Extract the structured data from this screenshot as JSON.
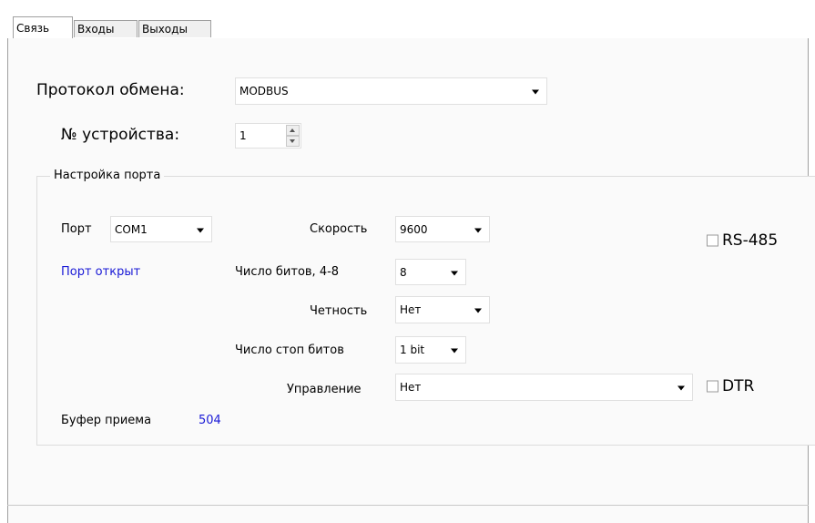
{
  "tabs": [
    {
      "label": "Связь",
      "active": true
    },
    {
      "label": "Входы",
      "active": false
    },
    {
      "label": "Выходы",
      "active": false
    }
  ],
  "protocol": {
    "label": "Протокол обмена:",
    "value": "MODBUS"
  },
  "device": {
    "label": "№ устройства:",
    "value": "1"
  },
  "port_settings": {
    "title": "Настройка порта",
    "port": {
      "label": "Порт",
      "value": "COM1"
    },
    "port_status": "Порт открыт",
    "speed": {
      "label": "Скорость",
      "value": "9600"
    },
    "data_bits": {
      "label": "Число битов, 4-8",
      "value": "8"
    },
    "parity": {
      "label": "Четность",
      "value": "Нет"
    },
    "stop_bits": {
      "label": "Число стоп битов",
      "value": "1 bit"
    },
    "flow_control": {
      "label": "Управление",
      "value": "Нет"
    },
    "rs485": {
      "label": "RS-485",
      "checked": false
    },
    "dtr": {
      "label": "DTR",
      "checked": false
    },
    "buffer": {
      "label": "Буфер приема",
      "value": "504"
    }
  },
  "colors": {
    "status_blue": "#1a1ad6"
  }
}
